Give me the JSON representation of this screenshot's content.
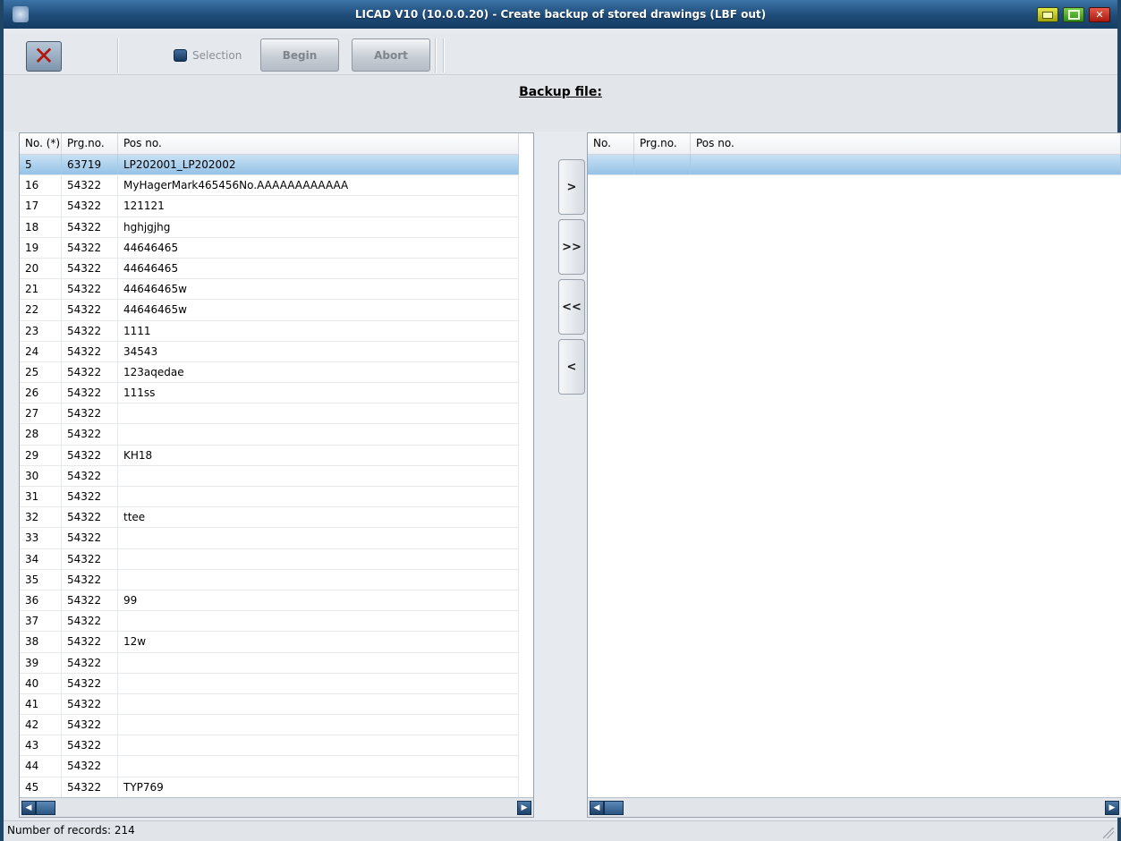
{
  "window": {
    "title": "LICAD V10 (10.0.0.20) - Create backup of stored drawings (LBF out)"
  },
  "toolbar": {
    "selection_label": "Selection",
    "begin_label": "Begin",
    "abort_label": "Abort"
  },
  "backup_label": "Backup file:",
  "left_table": {
    "headers": [
      "No. (*)",
      "Prg.no.",
      "Pos no."
    ],
    "selected_row_index": 0,
    "rows": [
      [
        "5",
        "63719",
        "LP202001_LP202002"
      ],
      [
        "16",
        "54322",
        "MyHagerMark465456No.AAAAAAAAAAAA"
      ],
      [
        "17",
        "54322",
        "121121"
      ],
      [
        "18",
        "54322",
        "hghjgjhg"
      ],
      [
        "19",
        "54322",
        "44646465"
      ],
      [
        "20",
        "54322",
        "44646465"
      ],
      [
        "21",
        "54322",
        "44646465w"
      ],
      [
        "22",
        "54322",
        "44646465w"
      ],
      [
        "23",
        "54322",
        "1111"
      ],
      [
        "24",
        "54322",
        "34543"
      ],
      [
        "25",
        "54322",
        "123aqedae"
      ],
      [
        "26",
        "54322",
        "111ss"
      ],
      [
        "27",
        "54322",
        ""
      ],
      [
        "28",
        "54322",
        ""
      ],
      [
        "29",
        "54322",
        "KH18"
      ],
      [
        "30",
        "54322",
        ""
      ],
      [
        "31",
        "54322",
        ""
      ],
      [
        "32",
        "54322",
        "ttee"
      ],
      [
        "33",
        "54322",
        ""
      ],
      [
        "34",
        "54322",
        ""
      ],
      [
        "35",
        "54322",
        ""
      ],
      [
        "36",
        "54322",
        "99"
      ],
      [
        "37",
        "54322",
        ""
      ],
      [
        "38",
        "54322",
        "12w"
      ],
      [
        "39",
        "54322",
        ""
      ],
      [
        "40",
        "54322",
        ""
      ],
      [
        "41",
        "54322",
        ""
      ],
      [
        "42",
        "54322",
        ""
      ],
      [
        "43",
        "54322",
        ""
      ],
      [
        "44",
        "54322",
        ""
      ],
      [
        "45",
        "54322",
        "TYP769"
      ]
    ]
  },
  "right_table": {
    "headers": [
      "No.",
      "Prg.no.",
      "Pos no."
    ],
    "rows": [
      [
        "",
        "",
        ""
      ]
    ]
  },
  "move_buttons": [
    ">",
    ">>",
    "<<",
    "<"
  ],
  "status": {
    "text": "Number of records: 214"
  },
  "colors": {
    "title_bar": "#1e4b77",
    "selected_row": "#94c2e6",
    "close_x": "#b3160d"
  }
}
